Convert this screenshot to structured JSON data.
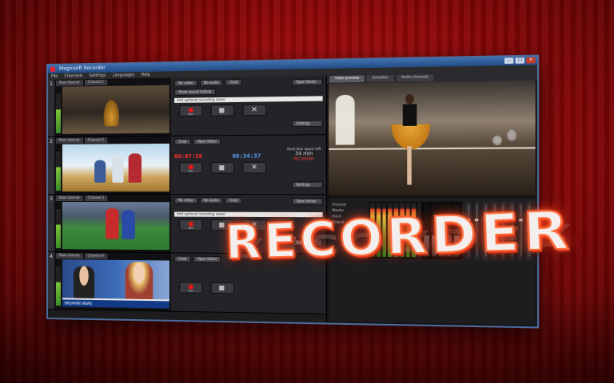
{
  "window": {
    "title": "Magicsoft Recorder",
    "controls": {
      "minimize": "–",
      "maximize": "□",
      "close": "×"
    }
  },
  "menu": [
    "File",
    "Channels",
    "Settings",
    "Languages",
    "Help"
  ],
  "channels": [
    {
      "number": "1",
      "tabs": [
        "Raw channel",
        "Channel 1"
      ],
      "rows": [
        "No video",
        "No audio",
        "Grab",
        "Show record hotkey"
      ],
      "name_placeholder": "Add optional recording name",
      "record_label": "REC",
      "side_buttons": [
        "Open folder",
        "Settings"
      ]
    },
    {
      "number": "2",
      "tabs": [
        "Raw channel",
        "Channel 2"
      ],
      "rows": [
        "Grab",
        "Open folder"
      ],
      "timer_elapsed": "00:07:58",
      "timer_total": "00:34:37",
      "remaining_label": "Hard disk space left",
      "remaining_value": "34 min",
      "recording_label": "RECORDING",
      "record_label": "REC",
      "side_buttons": [
        "Open folder",
        "Settings"
      ]
    },
    {
      "number": "3",
      "tabs": [
        "Raw channel",
        "Channel 3"
      ],
      "rows": [
        "No video",
        "No audio",
        "Grab"
      ],
      "name_placeholder": "Add optional recording name",
      "record_label": "REC",
      "side_buttons": [
        "Open folder",
        "Settings"
      ]
    },
    {
      "number": "4",
      "tabs": [
        "Raw channel",
        "Channel 4"
      ],
      "rows": [
        "Grab",
        "Open folder"
      ],
      "ticker": "BREAKING NEWS",
      "record_label": "REC",
      "side_buttons": [
        "Open folder",
        "Settings"
      ]
    }
  ],
  "right_pane": {
    "tabs": [
      "Video preview",
      "Schedule",
      "Audio channels"
    ],
    "mixer_labels": [
      "Channel",
      "Master",
      "Input",
      "Output"
    ]
  },
  "branding": {
    "title": "RECORDER"
  }
}
